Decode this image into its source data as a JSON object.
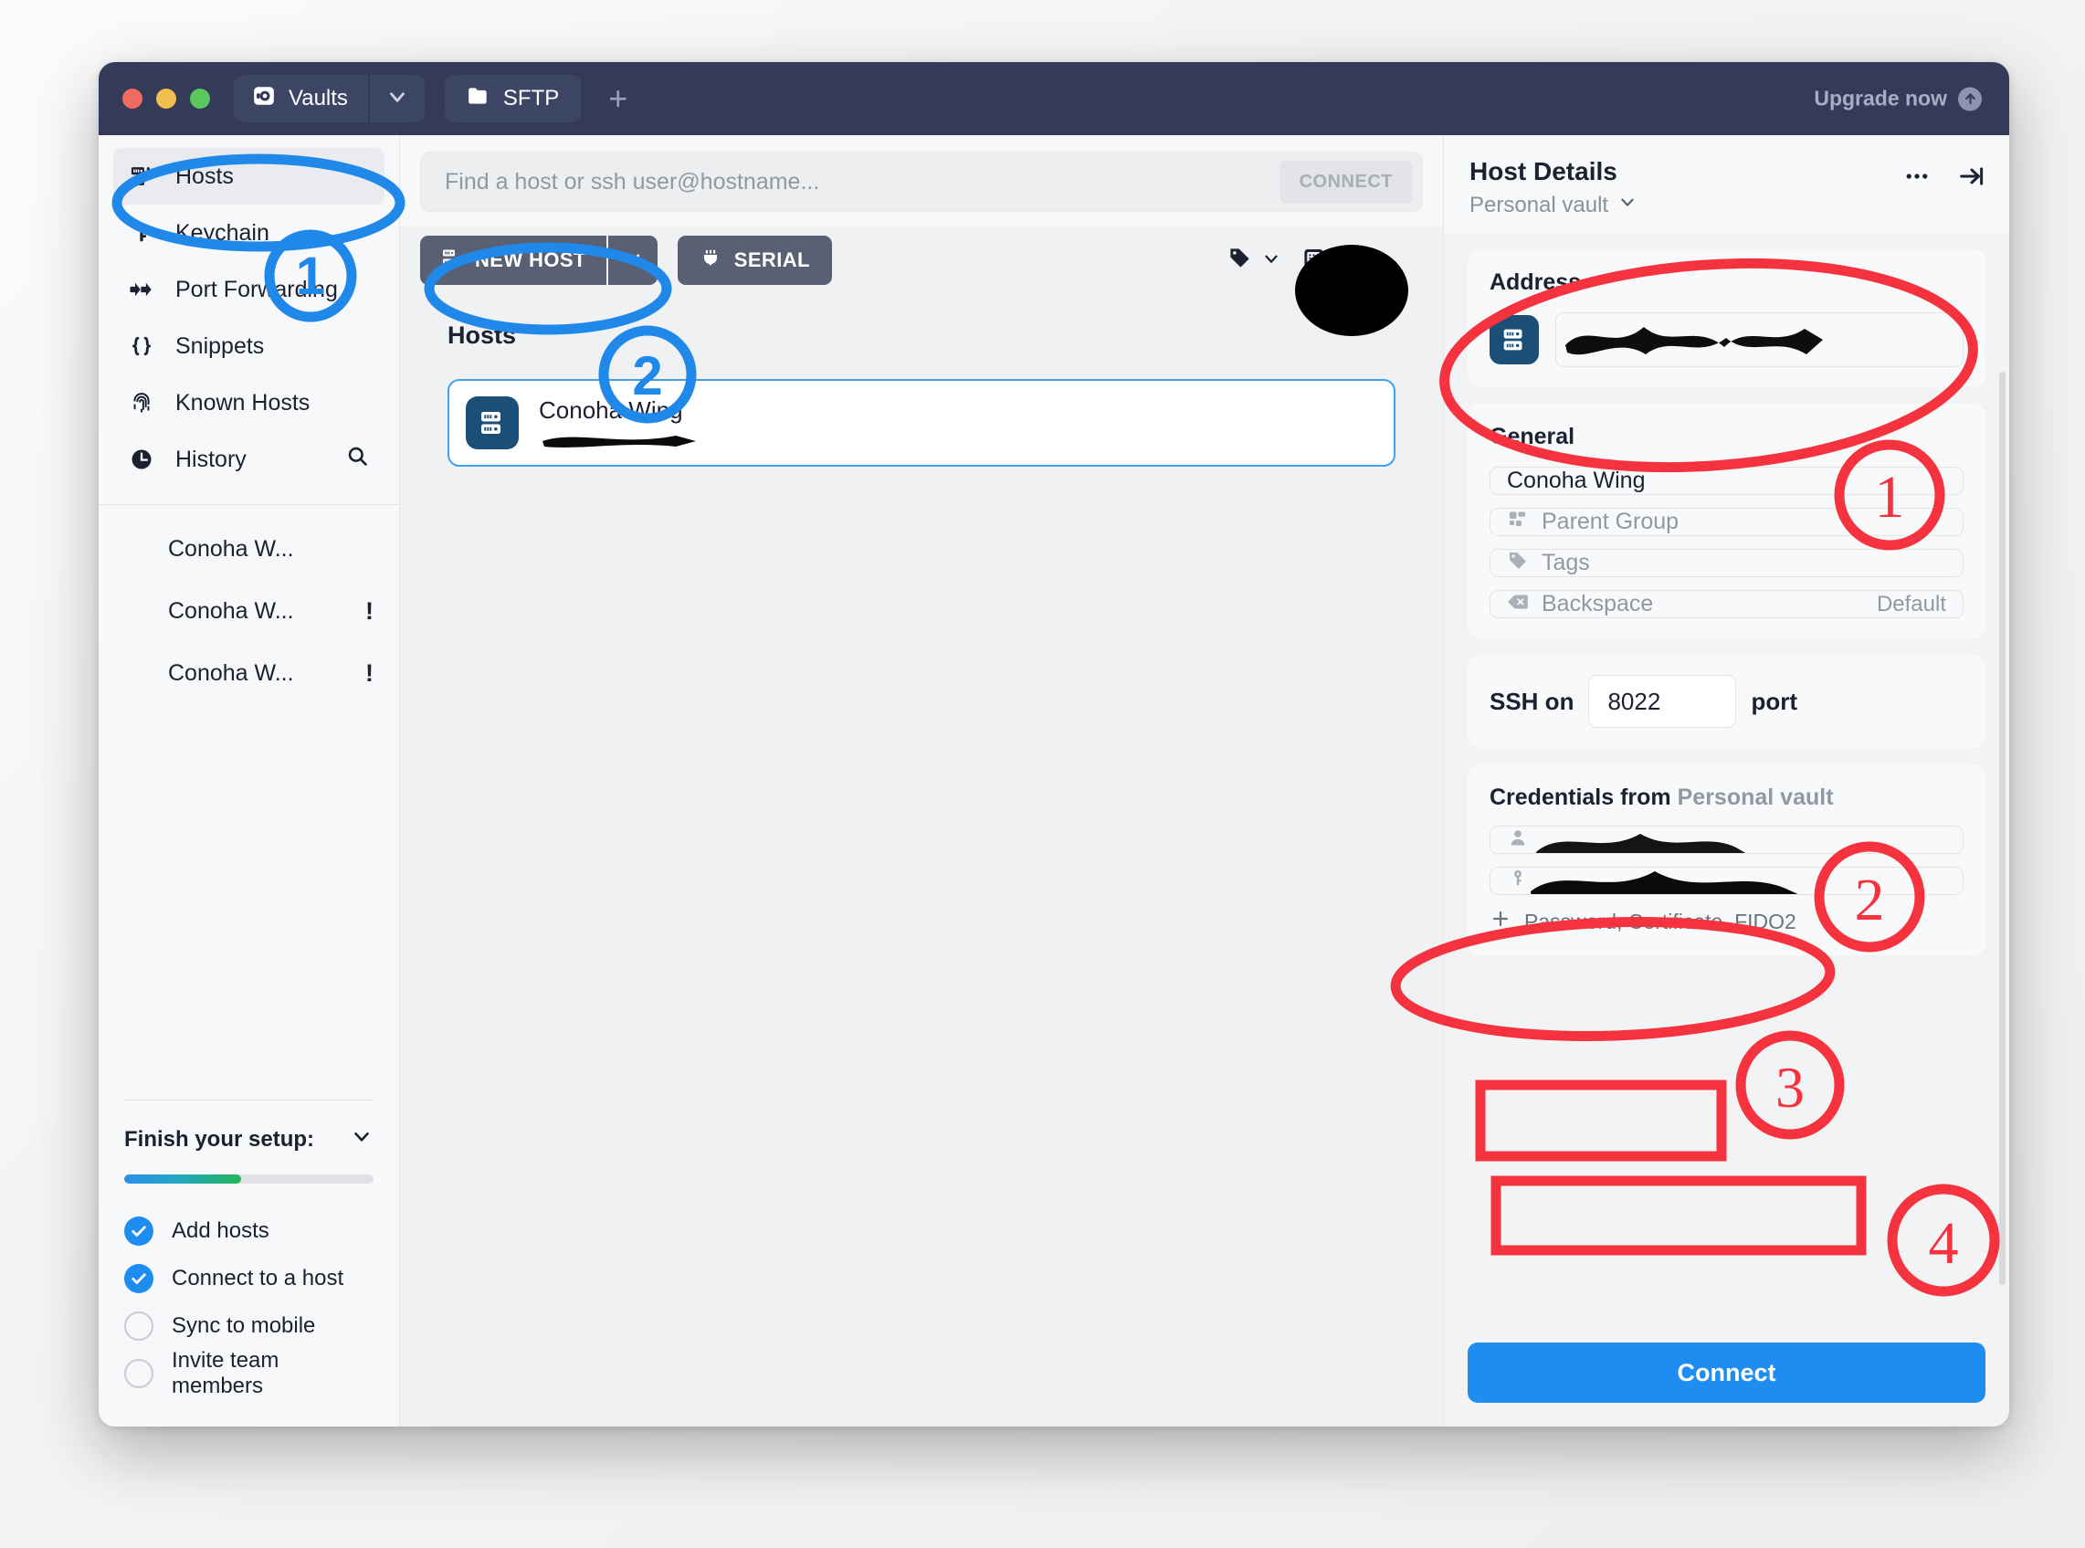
{
  "window": {
    "titlebar": {
      "vault_tab_label": "Vaults",
      "vault_tab_icon": "vault-icon",
      "vault_caret_icon": "chevron-down-icon",
      "sftp_tab_label": "SFTP",
      "sftp_tab_icon": "folder-icon",
      "new_tab_icon": "plus-icon",
      "upgrade_label": "Upgrade now",
      "upgrade_icon": "arrow-up-circle-icon",
      "traffic_lights": [
        "close-red",
        "minimize-yellow",
        "zoom-green"
      ]
    }
  },
  "sidebar": {
    "items": [
      {
        "label": "Hosts",
        "icon": "server-rack-icon",
        "active": true
      },
      {
        "label": "Keychain",
        "icon": "key-icon",
        "active": false
      },
      {
        "label": "Port Forwarding",
        "icon": "arrows-right-icon",
        "active": false
      },
      {
        "label": "Snippets",
        "icon": "braces-icon",
        "active": false
      },
      {
        "label": "Known Hosts",
        "icon": "fingerprint-icon",
        "active": false
      },
      {
        "label": "History",
        "icon": "clock-icon",
        "active": false,
        "trailing_icon": "search-icon"
      }
    ],
    "history": [
      {
        "label": "Conoha W...",
        "badge": ""
      },
      {
        "label": "Conoha W...",
        "badge": "!"
      },
      {
        "label": "Conoha W...",
        "badge": "!"
      }
    ],
    "setup": {
      "title": "Finish your setup:",
      "collapse_icon": "chevron-down-icon",
      "progress_percent": 47,
      "tasks": [
        {
          "label": "Add hosts",
          "done": true
        },
        {
          "label": "Connect to a host",
          "done": true
        },
        {
          "label": "Sync to mobile",
          "done": false
        },
        {
          "label": "Invite team members",
          "done": false
        }
      ]
    }
  },
  "center": {
    "search": {
      "placeholder": "Find a host or ssh user@hostname...",
      "connect_label": "CONNECT"
    },
    "toolbar": {
      "new_host_label": "NEW HOST",
      "new_host_icon": "server-rack-icon",
      "new_host_caret_icon": "chevron-down-icon",
      "serial_label": "SERIAL",
      "serial_icon": "plug-icon",
      "tag_filter_icon": "tag-icon",
      "tag_caret_icon": "chevron-down-icon",
      "grid_view_icon": "grid-icon",
      "grid_caret_icon": "chevron-down-icon"
    },
    "section_title": "Hosts",
    "hosts": [
      {
        "name": "Conoha Wing",
        "icon": "server-rack-icon",
        "subtitle_redacted": true,
        "selected": true
      }
    ]
  },
  "details": {
    "title": "Host Details",
    "vault_label": "Personal vault",
    "vault_caret_icon": "chevron-down-icon",
    "more_icon": "ellipsis-icon",
    "collapse_icon": "arrow-to-right-icon",
    "address": {
      "label": "Address",
      "icon": "server-rack-icon",
      "value_redacted": true
    },
    "general": {
      "label": "General",
      "name_value": "Conoha Wing",
      "parent_group_placeholder": "Parent Group",
      "parent_group_icon": "group-icon",
      "tags_placeholder": "Tags",
      "tags_icon": "tag-icon",
      "backspace_placeholder": "Backspace",
      "backspace_icon": "backspace-icon",
      "backspace_right_label": "Default"
    },
    "ssh": {
      "prefix_label": "SSH on",
      "port_value": "8022",
      "suffix_label": "port"
    },
    "credentials": {
      "heading": "Credentials from",
      "heading_vault": "Personal vault",
      "username_icon": "user-icon",
      "username_redacted": true,
      "password_icon": "key-icon",
      "password_redacted": true,
      "add_label": "Password, Certificate, FIDO2",
      "add_icon": "plus-icon"
    },
    "connect_button_label": "Connect"
  },
  "annotations": {
    "color_blue": "#1f88e8",
    "color_red": "#f5333f",
    "blue_markers": [
      {
        "number": "1",
        "target": "sidebar-item-hosts"
      },
      {
        "number": "2",
        "target": "new-host-button"
      }
    ],
    "red_markers": [
      {
        "number": "1",
        "target": "address-field"
      },
      {
        "number": "2",
        "target": "general-card"
      },
      {
        "number": "3",
        "target": "credentials-username-field"
      },
      {
        "number": "4",
        "target": "credentials-password-field"
      }
    ]
  }
}
